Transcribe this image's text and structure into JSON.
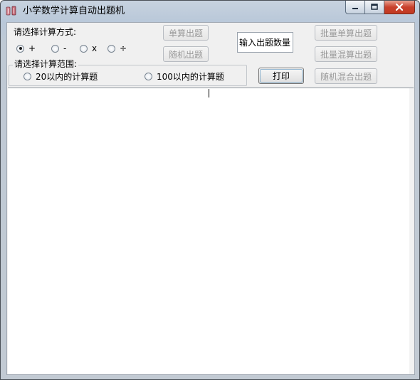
{
  "window": {
    "title": "小学数学计算自动出题机"
  },
  "operation": {
    "label": "请选择计算方式:",
    "options": [
      {
        "label": "+",
        "checked": true
      },
      {
        "label": "-",
        "checked": false
      },
      {
        "label": "x",
        "checked": false
      },
      {
        "label": "÷",
        "checked": false
      }
    ]
  },
  "range": {
    "label": "请选择计算范围:",
    "options": [
      {
        "label": "20以内的计算题",
        "checked": false
      },
      {
        "label": "100以内的计算题",
        "checked": false
      }
    ]
  },
  "buttons": {
    "single": "单算出题",
    "random": "随机出题",
    "print": "打印",
    "batch_single": "批量单算出题",
    "batch_mixed": "批量混算出题",
    "random_mixed": "随机混合出题"
  },
  "quantity_input": {
    "placeholder": "输入出题数量"
  },
  "colors": {
    "title_gradient_top": "#c7d2df",
    "client_bg": "#f0f0f0",
    "disabled_text": "#9a9a9a",
    "close_button": "#c8402c"
  },
  "icons": {
    "app": "app-icon",
    "minimize": "minimize-icon",
    "maximize": "maximize-icon",
    "close": "close-icon"
  }
}
